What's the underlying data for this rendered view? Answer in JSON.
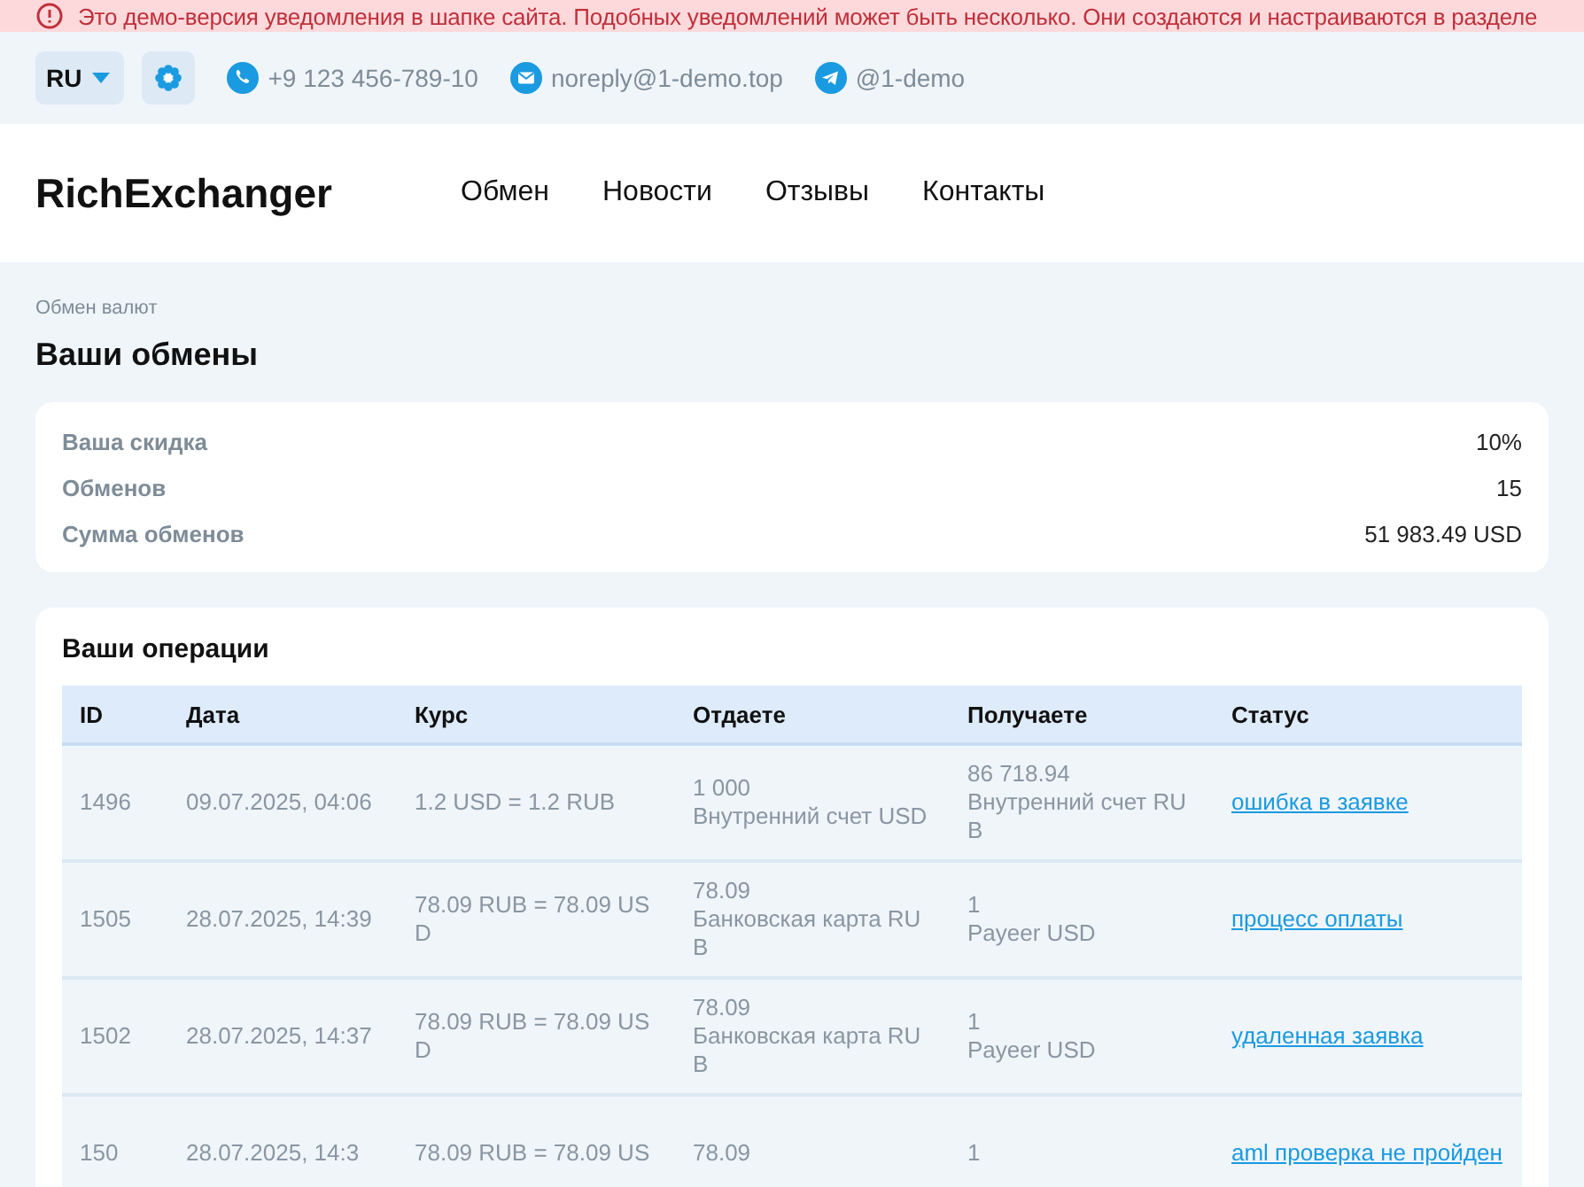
{
  "notice": {
    "text": "Это демо-версия уведомления в шапке сайта. Подобных уведомлений может быть несколько. Они создаются и настраиваются в разделе"
  },
  "topbar": {
    "language": "RU",
    "contacts": [
      {
        "kind": "phone",
        "text": "+9 123 456-789-10"
      },
      {
        "kind": "email",
        "text": "noreply@1-demo.top"
      },
      {
        "kind": "telegram",
        "text": "@1-demo"
      }
    ]
  },
  "header": {
    "logo": "RichExchanger",
    "nav": [
      "Обмен",
      "Новости",
      "Отзывы",
      "Контакты"
    ]
  },
  "breadcrumb": "Обмен валют",
  "title": "Ваши обмены",
  "stats": [
    {
      "label": "Ваша скидка",
      "value": "10%"
    },
    {
      "label": "Обменов",
      "value": "15"
    },
    {
      "label": "Сумма обменов",
      "value": "51 983.49 USD"
    }
  ],
  "operations": {
    "title": "Ваши операции",
    "columns": [
      "ID",
      "Дата",
      "Курс",
      "Отдаете",
      "Получаете",
      "Статус"
    ],
    "rows": [
      {
        "id": "1496",
        "date": "09.07.2025, 04:06",
        "rate": "1.2 USD = 1.2 RUB",
        "give_amount": "1 000",
        "give_method": "Внутренний счет USD",
        "get_amount": "86 718.94",
        "get_method": "Внутренний счет RUB",
        "status": "ошибка в заявке"
      },
      {
        "id": "1505",
        "date": "28.07.2025, 14:39",
        "rate": "78.09 RUB = 78.09 USD",
        "give_amount": "78.09",
        "give_method": "Банковская карта RUB",
        "get_amount": "1",
        "get_method": "Payeer USD",
        "status": "процесс оплаты"
      },
      {
        "id": "1502",
        "date": "28.07.2025, 14:37",
        "rate": "78.09 RUB = 78.09 USD",
        "give_amount": "78.09",
        "give_method": "Банковская карта RUB",
        "get_amount": "1",
        "get_method": "Payeer USD",
        "status": "удаленная заявка"
      },
      {
        "id": "150",
        "date": "28.07.2025, 14:3",
        "rate": "78.09 RUB = 78.09 US",
        "give_amount": "78.09",
        "get_amount": "1",
        "status": "aml проверка не пройден"
      }
    ]
  }
}
